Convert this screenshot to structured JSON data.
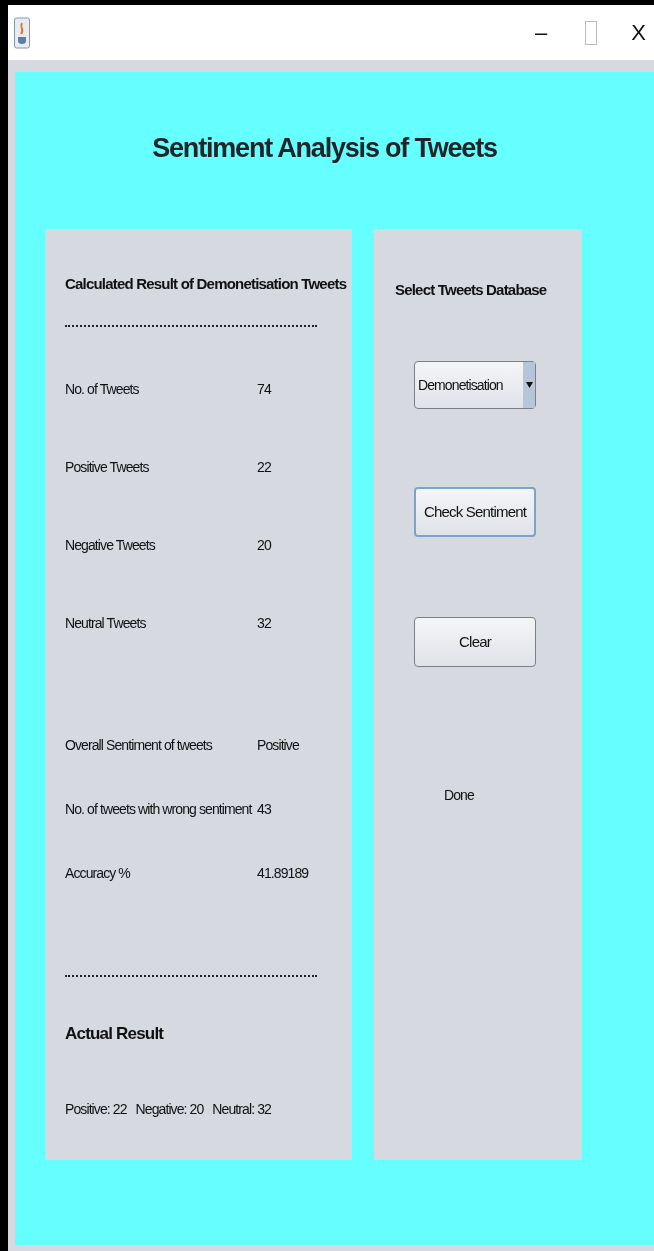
{
  "window": {
    "minimize": "–",
    "close": "X"
  },
  "title": "Sentiment Analysis of Tweets",
  "results": {
    "heading": "Calculated Result of Demonetisation Tweets",
    "counts": [
      {
        "label": "No. of Tweets",
        "value": "74"
      },
      {
        "label": "Positive Tweets",
        "value": "22"
      },
      {
        "label": "Negative Tweets",
        "value": "20"
      },
      {
        "label": "Neutral Tweets",
        "value": "32"
      }
    ],
    "summary": [
      {
        "label": "Overall Sentiment of tweets",
        "value": "Positive"
      },
      {
        "label": "No. of tweets with wrong sentiment",
        "value": "43"
      },
      {
        "label": "Accuracy %",
        "value": "41.89189"
      }
    ],
    "actual_heading": "Actual Result",
    "actual_text": "Positive: 22   Negative: 20   Neutral: 32"
  },
  "database": {
    "heading": "Select Tweets Database",
    "selected_option": "Demonetisation",
    "buttons": [
      {
        "label": "Check Sentiment",
        "focused": true
      },
      {
        "label": "Clear",
        "focused": false
      }
    ],
    "status": "Done"
  }
}
